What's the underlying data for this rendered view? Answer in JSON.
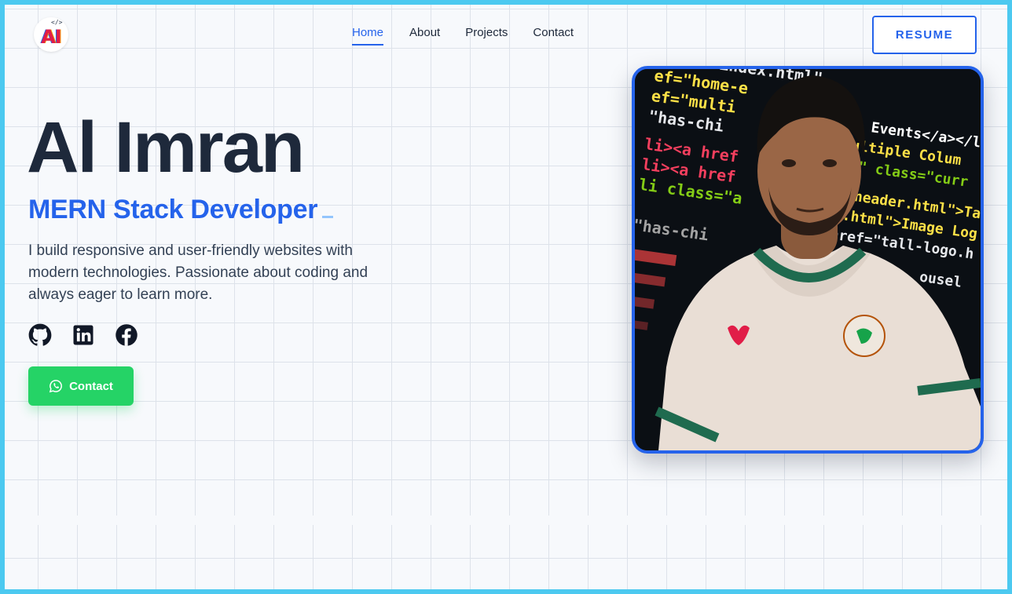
{
  "header": {
    "logo": {
      "text": "AI",
      "tag": "</>"
    },
    "nav": [
      {
        "label": "Home",
        "active": true
      },
      {
        "label": "About",
        "active": false
      },
      {
        "label": "Projects",
        "active": false
      },
      {
        "label": "Contact",
        "active": false
      }
    ],
    "resume_label": "RESUME"
  },
  "hero": {
    "name": "Al Imran",
    "role": "MERN Stack Developer",
    "bio": "I build responsive and user-friendly websites with modern technologies. Passionate about coding and always eager to learn more.",
    "socials": [
      {
        "icon": "github-icon"
      },
      {
        "icon": "linkedin-icon"
      },
      {
        "icon": "facebook-icon"
      }
    ],
    "contact_label": "Contact",
    "contact_icon": "whatsapp-icon"
  },
  "colors": {
    "accent": "#2563eb",
    "heading": "#1e293b",
    "whatsapp": "#25d366",
    "frame": "#4cc9f0"
  },
  "photo": {
    "background_code": [
      "ref=\"index.html\"",
      "ef=\"home-e",
      "ef=\"multi",
      "\"has-chi",
      "li><a href",
      "li><a href",
      "li class=\"a",
      "me Events</a></li>",
      "Multiple Colum",
      "f=\"#\" class=\"curr",
      "con-header.html\">Ta",
      "go.html\">Image Log",
      "href=\"tall-logo.h",
      "\"has-chi",
      "ousel"
    ]
  }
}
